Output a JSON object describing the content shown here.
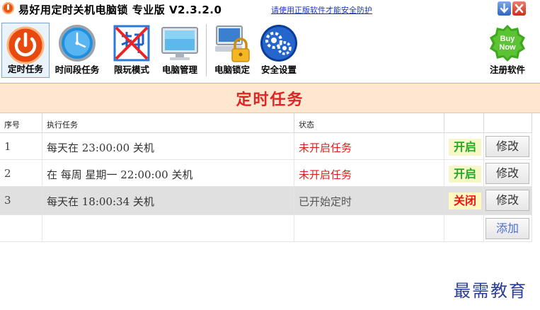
{
  "window": {
    "title": "易好用定时关机电脑锁 专业版 V2.3.2.0",
    "notice_link": "请使用正版软件才能安全防护"
  },
  "toolbar": {
    "items": [
      {
        "label": "定时任务",
        "icon": "power-icon"
      },
      {
        "label": "时间段任务",
        "icon": "clock-icon"
      },
      {
        "label": "限玩模式",
        "icon": "no-play-icon"
      },
      {
        "label": "电脑管理",
        "icon": "monitor-icon"
      },
      {
        "label": "电脑锁定",
        "icon": "computer-lock-icon"
      },
      {
        "label": "安全设置",
        "icon": "gear-icon"
      }
    ],
    "register": {
      "label": "注册软件",
      "badge_line1": "Buy",
      "badge_line2": "Now"
    }
  },
  "panel": {
    "title": "定时任务"
  },
  "table": {
    "headers": [
      "序号",
      "执行任务",
      "状态",
      ""
    ],
    "rows": [
      {
        "index": "1",
        "task": "每天在 23:00:00 关机",
        "status": "未开启任务",
        "toggle": "开启",
        "edit": "修改"
      },
      {
        "index": "2",
        "task": "在 每周 星期一 22:00:00 关机",
        "status": "未开启任务",
        "toggle": "开启",
        "edit": "修改"
      },
      {
        "index": "3",
        "task": "每天在 18:00:34 关机",
        "status": "已开始定时",
        "toggle": "关闭",
        "edit": "修改"
      }
    ],
    "add_label": "添加"
  },
  "watermark": "最需教育",
  "colors": {
    "header_band": "#fde7d1",
    "header_title": "#e02323",
    "status_off": "#e21d1d",
    "toggle_on": "#22aa22",
    "toggle_off": "#ee1111",
    "link": "#1a33cc"
  }
}
